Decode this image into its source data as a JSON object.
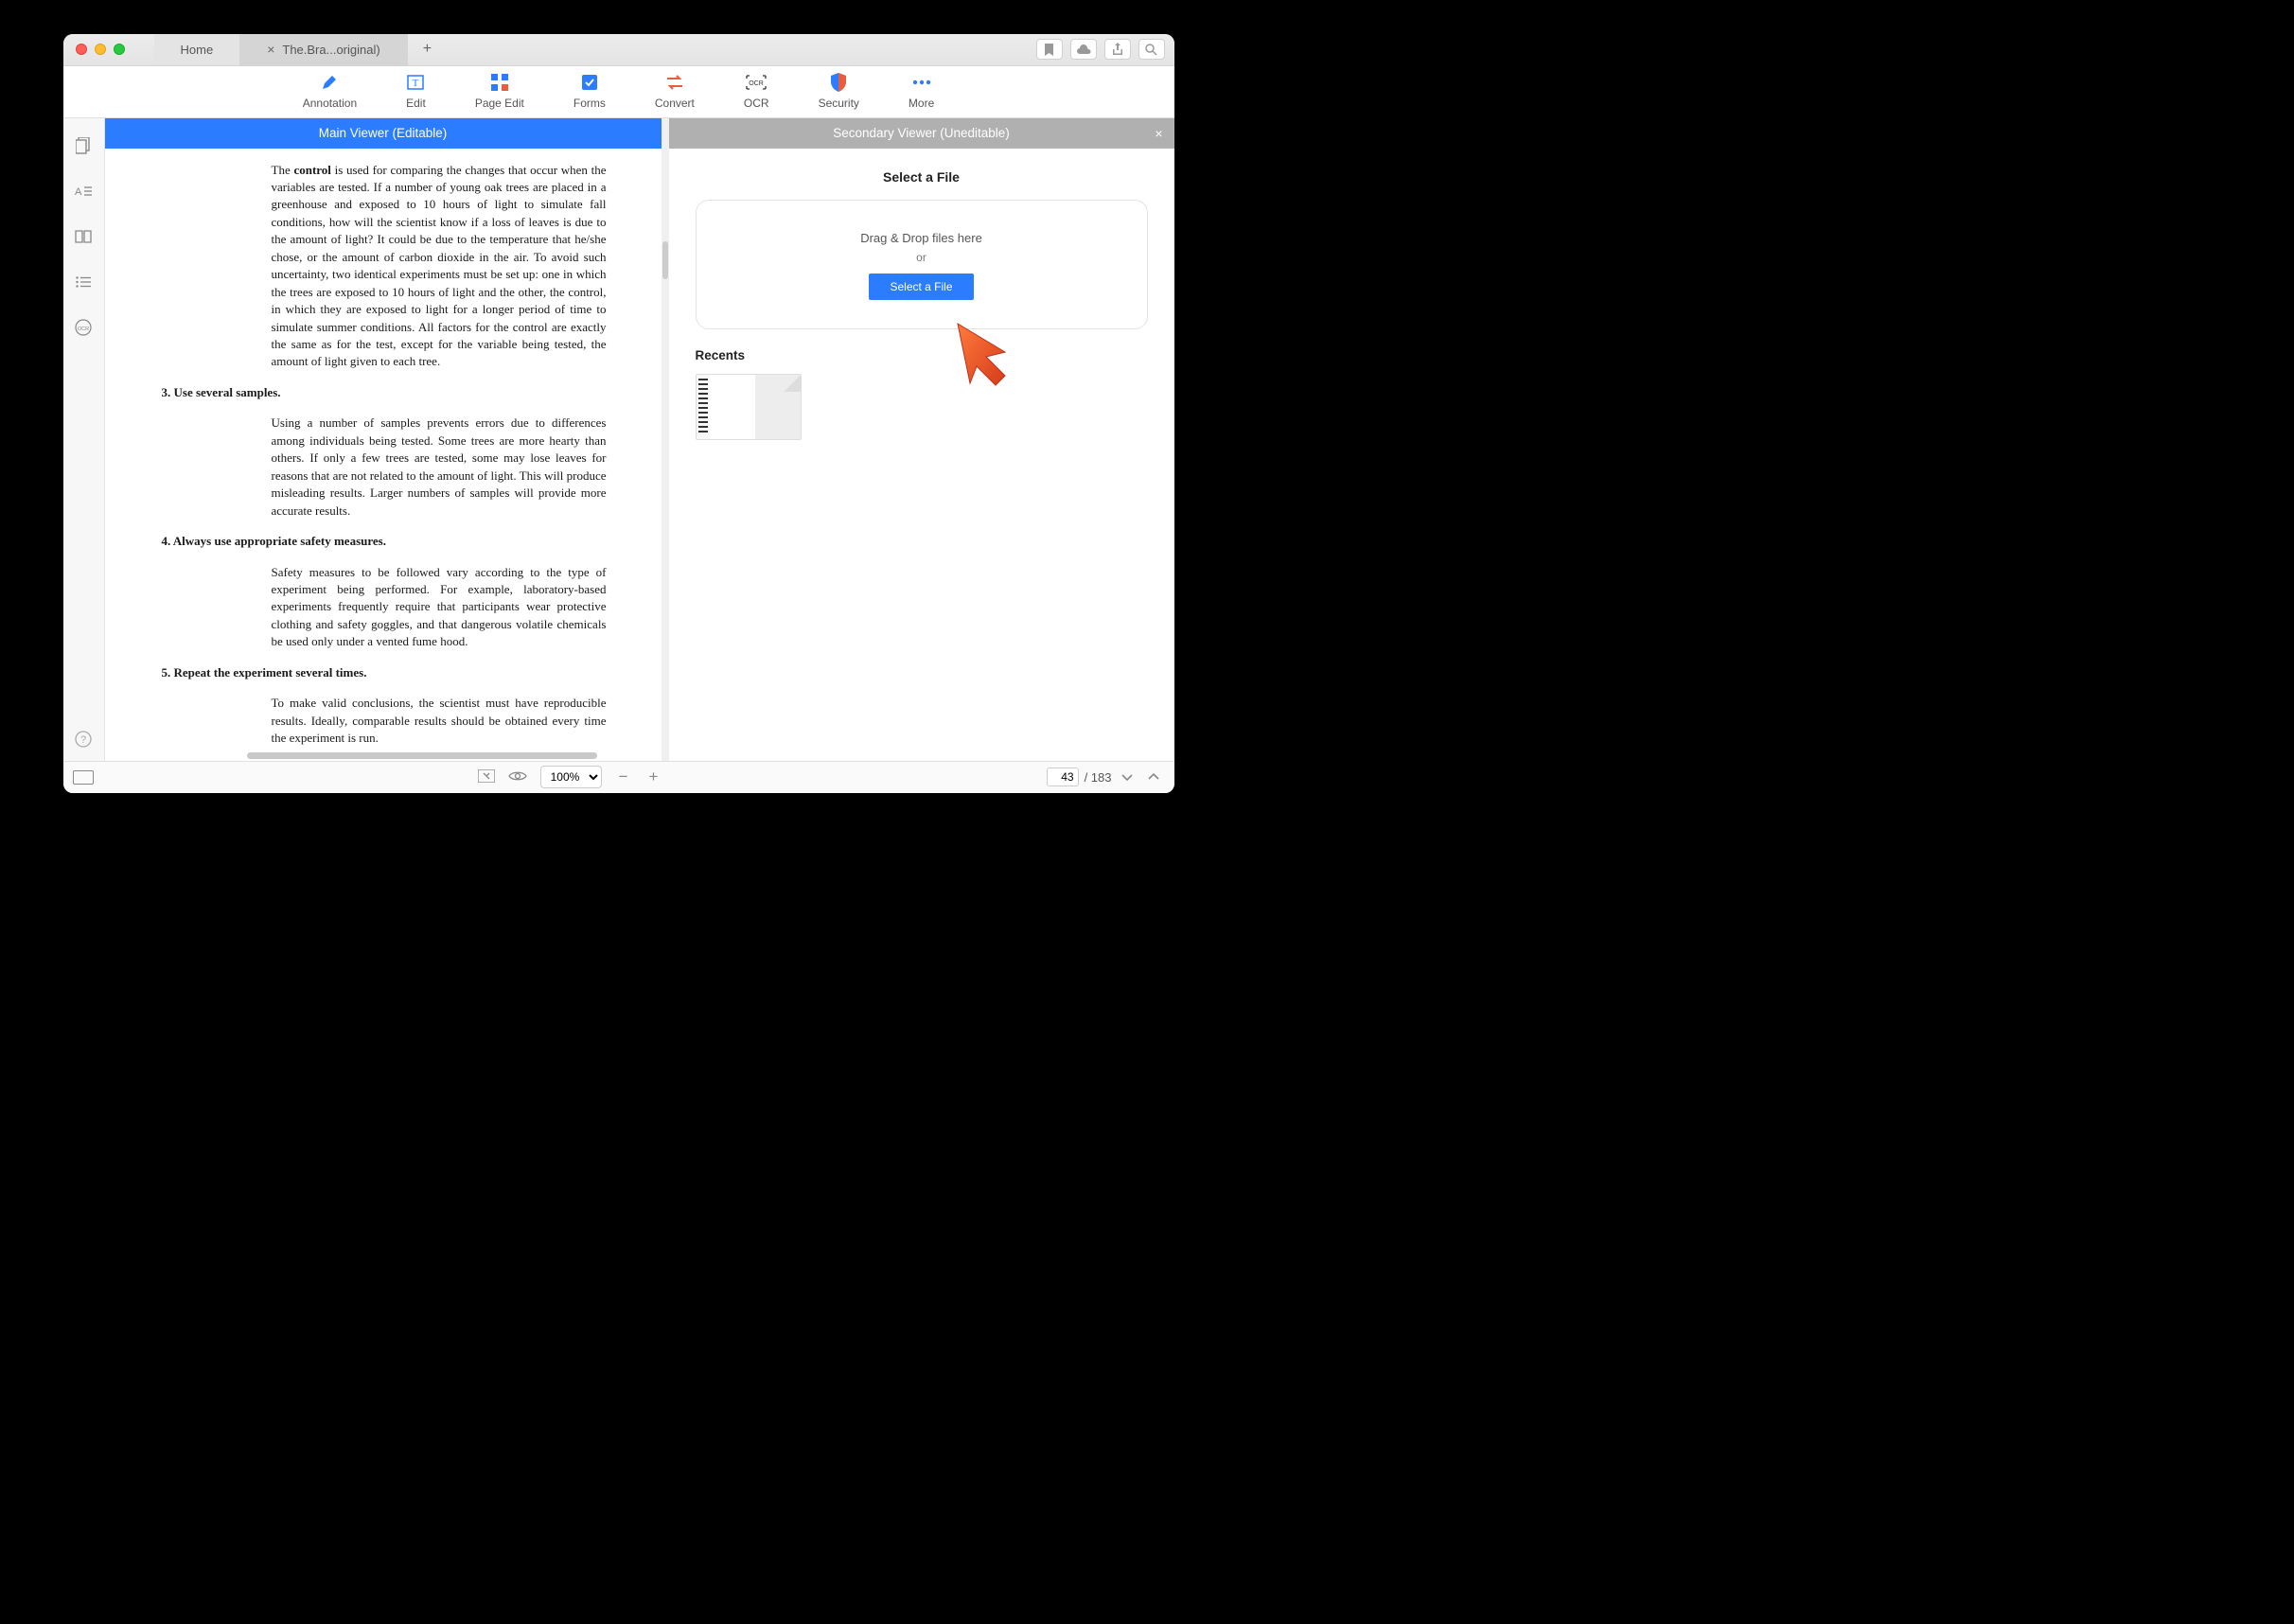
{
  "titlebar": {
    "tabs": {
      "home": "Home",
      "active": "The.Bra...original)"
    }
  },
  "toolbar": {
    "annotation": "Annotation",
    "edit": "Edit",
    "page_edit": "Page Edit",
    "forms": "Forms",
    "convert": "Convert",
    "ocr": "OCR",
    "security": "Security",
    "more": "More"
  },
  "panels": {
    "main_title": "Main Viewer (Editable)",
    "secondary_title": "Secondary Viewer (Uneditable)"
  },
  "document": {
    "p1_pre": "The ",
    "p1_bold": "control",
    "p1_post": " is used for comparing the changes that occur when the variables are tested. If a number of young oak trees are placed in a greenhouse and exposed to 10 hours of light to simulate fall conditions, how will the scientist know if a loss of leaves is due to the amount of light? It could be due to the temperature that he/she chose, or the amount of carbon dioxide in the air. To avoid such uncertainty, two identical experiments must be set up: one in which the trees are exposed to 10 hours of light and the other, the control, in which they are exposed to light for a longer period of time to simulate summer conditions. All factors for the control are exactly the same as for the test, except for the variable being tested, the amount of light given to each tree.",
    "h3": "3. Use several samples.",
    "p3": "Using a number of samples prevents errors due to differences among individuals being tested. Some trees are more hearty than others. If only a few trees are tested, some may lose leaves for reasons that are not related to the amount of light. This will produce misleading results. Larger numbers of samples will provide more accurate results.",
    "h4": "4. Always use appropriate safety measures.",
    "p4": "Safety measures to be followed vary according to the type of experiment being performed. For example, laboratory-based experiments frequently require that participants wear protective clothing and safety goggles, and that dangerous volatile chemicals be used only under a vented fume hood.",
    "h5": "5. Repeat the experiment several times.",
    "p5": "To make valid conclusions, the scientist must have reproducible results. Ideally, comparable results should be obtained every time the experiment is run."
  },
  "file_select": {
    "heading": "Select a File",
    "drag_drop": "Drag & Drop files here",
    "or": "or",
    "button": "Select a File",
    "recents": "Recents"
  },
  "statusbar": {
    "zoom": "100%",
    "page_current": "43",
    "page_total": "/ 183"
  }
}
